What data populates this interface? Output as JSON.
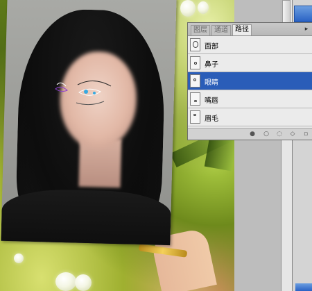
{
  "paths_panel": {
    "tabs": [
      "图层",
      "通道",
      "路径"
    ],
    "active_tab": "路径",
    "menu_icon": "menu-arrow-icon",
    "paths": [
      {
        "label": "面部",
        "selected": false
      },
      {
        "label": "鼻子",
        "selected": false
      },
      {
        "label": "眼睛",
        "selected": true
      },
      {
        "label": "嘴唇",
        "selected": false
      },
      {
        "label": "眉毛",
        "selected": false
      }
    ],
    "footer_icons": [
      "fill-path-icon",
      "stroke-path-icon",
      "load-selection-icon",
      "work-path-icon",
      "new-path-icon"
    ]
  },
  "colors": {
    "selection": "#2a5db8",
    "path_stroke": "#ffffff",
    "anchor": "#36a9e1"
  }
}
